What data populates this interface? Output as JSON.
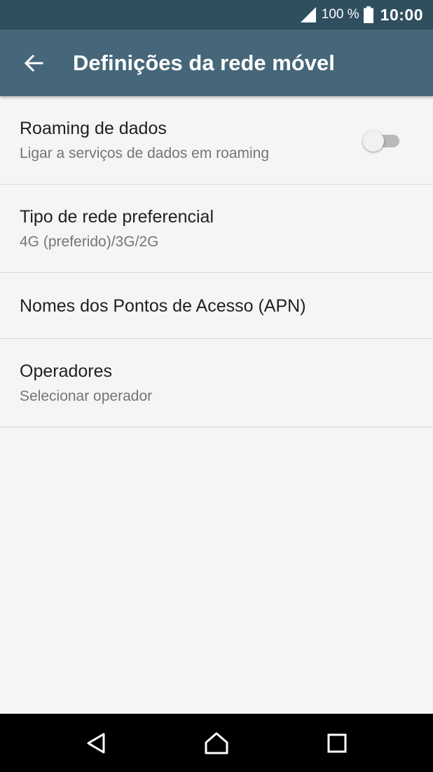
{
  "status_bar": {
    "battery_percent": "100 %",
    "time": "10:00",
    "icons": [
      "signal-icon",
      "battery-icon"
    ]
  },
  "app_bar": {
    "title": "Definições da rede móvel",
    "back_icon": "arrow-back-icon"
  },
  "settings": [
    {
      "title": "Roaming de dados",
      "subtitle": "Ligar a serviços de dados em roaming",
      "toggle": false
    },
    {
      "title": "Tipo de rede preferencial",
      "subtitle": "4G (preferido)/3G/2G"
    },
    {
      "title": "Nomes dos Pontos de Acesso (APN)"
    },
    {
      "title": "Operadores",
      "subtitle": "Selecionar operador"
    }
  ],
  "nav_bar": {
    "icons": [
      "nav-back-icon",
      "nav-home-icon",
      "nav-recents-icon"
    ]
  },
  "colors": {
    "status_bar": "#2f4f5f",
    "app_bar": "#466779",
    "background": "#f5f5f5",
    "primary_text": "#212121",
    "secondary_text": "#757575",
    "divider": "#d9d9d9"
  }
}
